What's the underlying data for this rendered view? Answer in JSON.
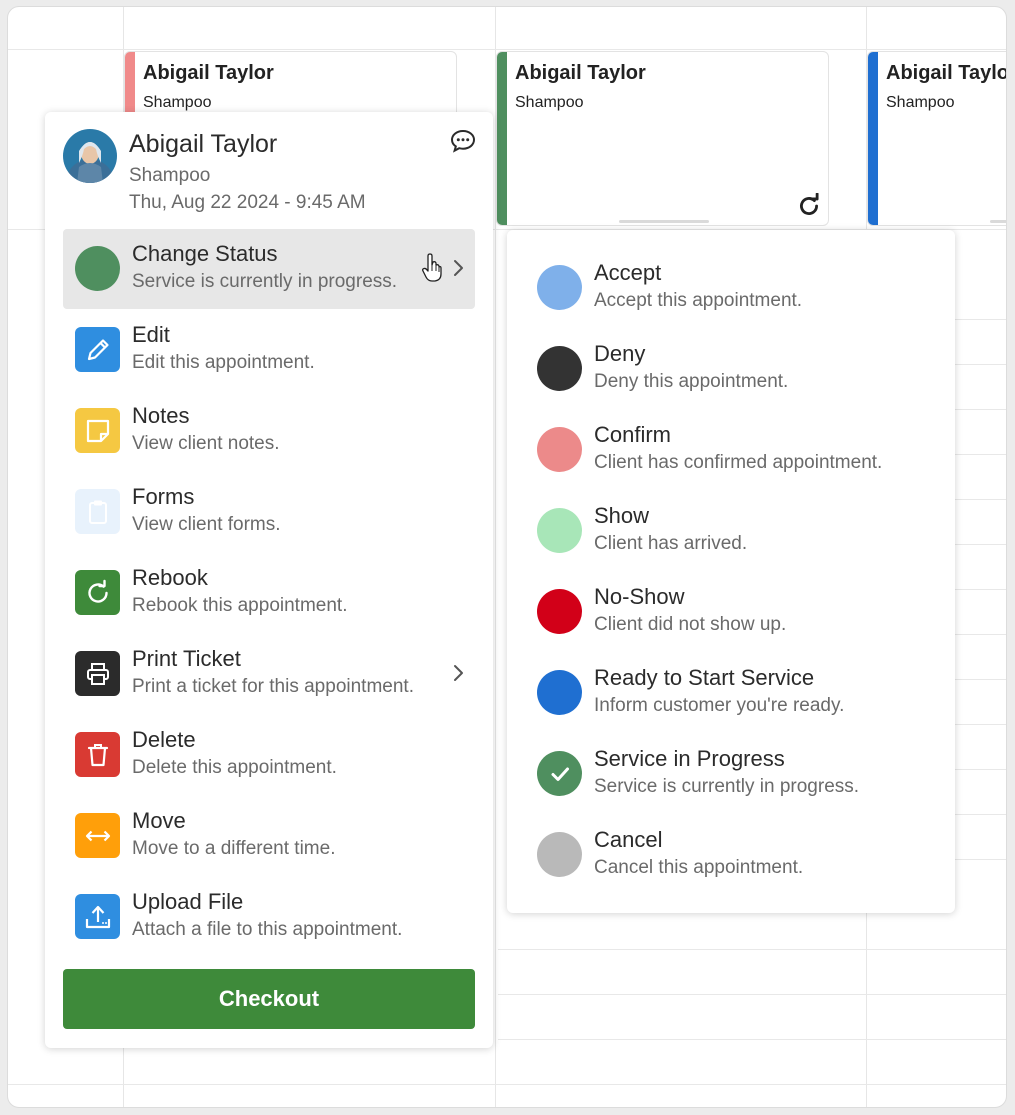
{
  "calendar": {
    "appointments": [
      {
        "name": "Abigail Taylor",
        "service": "Shampoo",
        "color": "#f08a8a"
      },
      {
        "name": "Abigail Taylor",
        "service": "Shampoo",
        "color": "#4f8f5f"
      },
      {
        "name": "Abigail Taylor",
        "service": "Shampoo",
        "color": "#1f6fd1"
      }
    ]
  },
  "popup": {
    "client_name": "Abigail Taylor",
    "service": "Shampoo",
    "datetime": "Thu, Aug 22 2024 - 9:45 AM",
    "menu": [
      {
        "label": "Change Status",
        "desc": "Service is currently in progress.",
        "icon": "status-dot",
        "color": "#4f8f5f"
      },
      {
        "label": "Edit",
        "desc": "Edit this appointment.",
        "icon": "pencil-icon",
        "color": "#2f8ee0"
      },
      {
        "label": "Notes",
        "desc": "View client notes.",
        "icon": "sticky-note-icon",
        "color": "#f5c842"
      },
      {
        "label": "Forms",
        "desc": "View client forms.",
        "icon": "clipboard-icon",
        "color": "#e8f2fc"
      },
      {
        "label": "Rebook",
        "desc": "Rebook this appointment.",
        "icon": "rebook-icon",
        "color": "#3e8a3a"
      },
      {
        "label": "Print Ticket",
        "desc": "Print a ticket for this appointment.",
        "icon": "printer-icon",
        "color": "#2b2b2b"
      },
      {
        "label": "Delete",
        "desc": "Delete this appointment.",
        "icon": "trash-icon",
        "color": "#d93a33"
      },
      {
        "label": "Move",
        "desc": "Move to a different time.",
        "icon": "move-arrows-icon",
        "color": "#ff9f0a"
      },
      {
        "label": "Upload File",
        "desc": "Attach a file to this appointment.",
        "icon": "upload-icon",
        "color": "#2f8ee0"
      }
    ],
    "checkout_label": "Checkout"
  },
  "status_menu": [
    {
      "label": "Accept",
      "desc": "Accept this appointment.",
      "color": "#7fb0ea"
    },
    {
      "label": "Deny",
      "desc": "Deny this appointment.",
      "color": "#333333"
    },
    {
      "label": "Confirm",
      "desc": "Client has confirmed appointment.",
      "color": "#ec8a8a"
    },
    {
      "label": "Show",
      "desc": "Client has arrived.",
      "color": "#a8e6b8"
    },
    {
      "label": "No-Show",
      "desc": "Client did not show up.",
      "color": "#d20018"
    },
    {
      "label": "Ready to Start Service",
      "desc": "Inform customer you're ready.",
      "color": "#1f6fd1"
    },
    {
      "label": "Service in Progress",
      "desc": "Service is currently in progress.",
      "color": "#4f8f5f",
      "selected": true
    },
    {
      "label": "Cancel",
      "desc": "Cancel this appointment.",
      "color": "#b9b9b9"
    }
  ]
}
